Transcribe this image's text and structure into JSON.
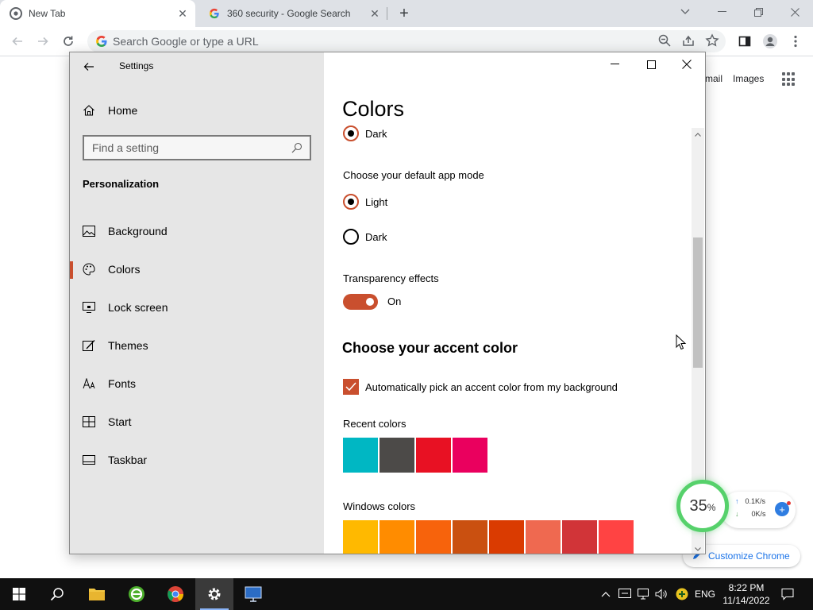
{
  "colors": {
    "accent": "#c94f2e",
    "chrome_tabstrip": "#dee1e6",
    "sidebar_bg": "#e6e6e6",
    "taskbar_bg": "#101010",
    "ring_green": "#56d16b"
  },
  "browser": {
    "tabs": [
      {
        "title": "New Tab",
        "icon": "chrome-icon",
        "active": true
      },
      {
        "title": "360 security - Google Search",
        "icon": "google-icon",
        "active": false
      }
    ],
    "omnibox_placeholder": "Search Google or type a URL"
  },
  "ntp": {
    "gmail_label": "mail",
    "images_label": "Images",
    "customize_label": "Customize Chrome"
  },
  "settings": {
    "app_title": "Settings",
    "home_label": "Home",
    "search_placeholder": "Find a setting",
    "section_label": "Personalization",
    "nav": [
      {
        "label": "Background",
        "icon": "picture-icon",
        "selected": false
      },
      {
        "label": "Colors",
        "icon": "palette-icon",
        "selected": true
      },
      {
        "label": "Lock screen",
        "icon": "lock-screen-icon",
        "selected": false
      },
      {
        "label": "Themes",
        "icon": "themes-icon",
        "selected": false
      },
      {
        "label": "Fonts",
        "icon": "fonts-icon",
        "selected": false
      },
      {
        "label": "Start",
        "icon": "start-icon",
        "selected": false
      },
      {
        "label": "Taskbar",
        "icon": "taskbar-icon",
        "selected": false
      }
    ],
    "page_title": "Colors",
    "windows_mode_option": {
      "label": "Dark",
      "checked": true
    },
    "app_mode_label": "Choose your default app mode",
    "app_mode_options": [
      {
        "label": "Light",
        "checked": true
      },
      {
        "label": "Dark",
        "checked": false
      }
    ],
    "transparency_label": "Transparency effects",
    "transparency_state": "On",
    "accent_heading": "Choose your accent color",
    "auto_accent_label": "Automatically pick an accent color from my background",
    "auto_accent_checked": true,
    "recent_colors_label": "Recent colors",
    "recent_colors": [
      "#00b7c3",
      "#4c4a48",
      "#e81123",
      "#ea005e"
    ],
    "windows_colors_label": "Windows colors",
    "windows_colors": [
      "#ffb900",
      "#ff8c00",
      "#f7630c",
      "#ca5010",
      "#da3b01",
      "#ef6950",
      "#d13438",
      "#ff4343"
    ]
  },
  "net_widget": {
    "percent": "35",
    "percent_sign": "%",
    "upload": "0.1K/s",
    "download": "0K/s"
  },
  "taskbar": {
    "language": "ENG",
    "time": "8:22 PM",
    "date": "11/14/2022"
  }
}
